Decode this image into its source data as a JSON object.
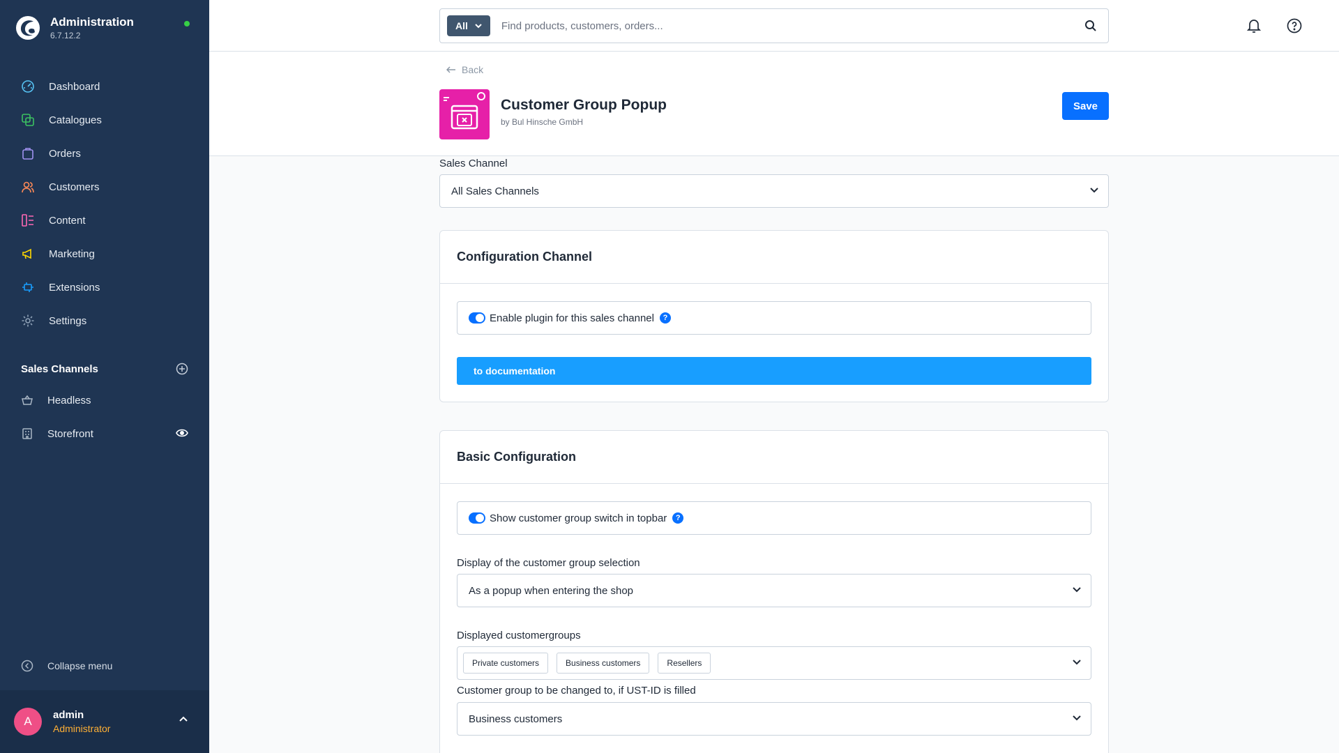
{
  "app": {
    "title": "Administration",
    "version": "6.7.12.2"
  },
  "nav": [
    {
      "label": "Dashboard",
      "icon": "dashboard-icon"
    },
    {
      "label": "Catalogues",
      "icon": "catalogue-icon"
    },
    {
      "label": "Orders",
      "icon": "orders-icon"
    },
    {
      "label": "Customers",
      "icon": "customers-icon"
    },
    {
      "label": "Content",
      "icon": "content-icon"
    },
    {
      "label": "Marketing",
      "icon": "marketing-icon"
    },
    {
      "label": "Extensions",
      "icon": "extensions-icon"
    },
    {
      "label": "Settings",
      "icon": "settings-icon"
    }
  ],
  "sales_channels": {
    "title": "Sales Channels",
    "items": [
      {
        "label": "Headless",
        "icon": "basket-icon"
      },
      {
        "label": "Storefront",
        "icon": "storefront-icon"
      }
    ]
  },
  "collapse_label": "Collapse menu",
  "user": {
    "initial": "A",
    "name": "admin",
    "role": "Administrator"
  },
  "search": {
    "type": "All",
    "placeholder": "Find products, customers, orders..."
  },
  "header": {
    "back": "Back",
    "title": "Customer Group Popup",
    "by": "by Bul Hinsche GmbH",
    "save": "Save"
  },
  "sales_channel": {
    "label": "Sales Channel",
    "value": "All Sales Channels"
  },
  "config_channel": {
    "title": "Configuration Channel",
    "enable_label": "Enable plugin for this sales channel",
    "enable_on": true,
    "doc_button": "to documentation"
  },
  "basic_config": {
    "title": "Basic Configuration",
    "switch_label": "Show customer group switch in topbar",
    "switch_on": true,
    "display_label": "Display of the customer group selection",
    "display_value": "As a popup when entering the shop",
    "groups_label": "Displayed customergroups",
    "groups": [
      "Private customers",
      "Business customers",
      "Resellers"
    ],
    "ustid_label": "Customer group to be changed to, if UST-ID is filled",
    "ustid_value": "Business customers"
  },
  "colors": {
    "sidebar": "#1f3553",
    "primary": "#0870ff",
    "doc_button": "#189eff",
    "plugin_icon": "#e620a8"
  }
}
